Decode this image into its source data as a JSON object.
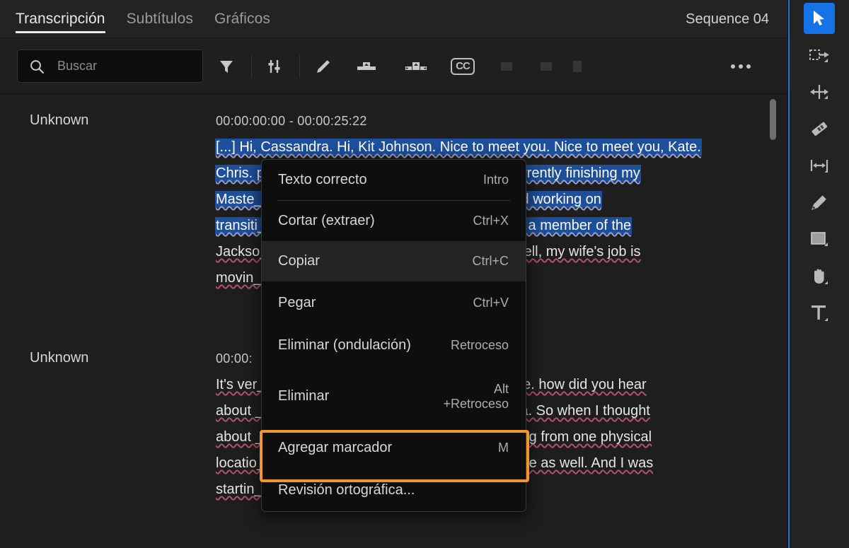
{
  "app": {
    "sequence_title": "Sequence 04"
  },
  "tabs": [
    {
      "label": "Transcripción",
      "active": true
    },
    {
      "label": "Subtítulos",
      "active": false
    },
    {
      "label": "Gráficos",
      "active": false
    }
  ],
  "toolbar": {
    "search_placeholder": "Buscar",
    "search_value": "",
    "icons": [
      {
        "name": "search-icon"
      },
      {
        "name": "filter-funnel-icon"
      },
      {
        "name": "sliders-icon"
      },
      {
        "name": "pencil-edit-icon"
      },
      {
        "name": "merge-clips-icon"
      },
      {
        "name": "split-clip-icon"
      },
      {
        "name": "closed-captions-icon",
        "label": "CC"
      },
      {
        "name": "more-options-icon"
      }
    ]
  },
  "transcript": {
    "blocks": [
      {
        "speaker": "Unknown",
        "timecode": "00:00:00:00 - 00:00:25:22",
        "lines": [
          {
            "text": "[...] Hi, Cassandra. Hi, Kit Johnson. Nice to meet you. Nice to meet you, Kate.",
            "selected": true
          },
          {
            "text": "Chris. p____________________________ 'm currently finishing my",
            "selected": true
          },
          {
            "text": "Maste___________________________ lege, and working on",
            "selected": true
          },
          {
            "text": "transiti___________________________ to being a member of the",
            "selected": true
          },
          {
            "text": "Jackso___________________________ ove? Well, my wife's job is",
            "selected": false
          },
          {
            "text": "movin____________________________ th her.",
            "selected": false
          }
        ]
      },
      {
        "speaker": "Unknown",
        "timecode": "00:00:",
        "lines": [
          {
            "text": "It's ver__________________________ same time. how did you hear",
            "selected": false
          },
          {
            "text": "about ___________________________ re at Aria. So when I thought",
            "selected": false
          },
          {
            "text": "about ___________________________ nd moving from one physical",
            "selected": false
          },
          {
            "text": "locatio__________________________ areer move as well. And I was",
            "selected": false
          },
          {
            "text": "startin__________________________",
            "selected": false
          }
        ]
      }
    ]
  },
  "context_menu": {
    "items": [
      {
        "label": "Texto correcto",
        "accel": "Intro",
        "separator_after": true,
        "hover": false
      },
      {
        "label": "Cortar (extraer)",
        "accel": "Ctrl+X",
        "hover": false
      },
      {
        "label": "Copiar",
        "accel": "Ctrl+C",
        "hover": true
      },
      {
        "label": "Pegar",
        "accel": "Ctrl+V",
        "hover": false
      },
      {
        "label": "Eliminar (ondulación)",
        "accel": "Retroceso",
        "hover": false
      },
      {
        "label": "Eliminar",
        "accel": "Alt\n+Retroceso",
        "hover": false,
        "two_line": true
      },
      {
        "label": "Agregar marcador",
        "accel": "M",
        "hover": false,
        "highlighted": true
      },
      {
        "label": "Revisión ortográfica...",
        "accel": "",
        "hover": false
      }
    ]
  },
  "tools": [
    {
      "name": "selection-tool",
      "active": true
    },
    {
      "name": "track-select-forward-tool",
      "active": false
    },
    {
      "name": "ripple-edit-tool",
      "active": false
    },
    {
      "name": "razor-tool",
      "active": false
    },
    {
      "name": "rate-stretch-tool",
      "active": false
    },
    {
      "name": "pen-tool",
      "active": false
    },
    {
      "name": "rectangle-tool",
      "active": false
    },
    {
      "name": "hand-tool",
      "active": false
    },
    {
      "name": "type-tool",
      "active": false
    }
  ],
  "colors": {
    "accent_blue": "#1473e6",
    "selection_blue": "#1d4f9c",
    "annotation_orange": "#f0952a",
    "panel_bg": "#1e1e1e",
    "menu_bg": "#0e0e0e"
  }
}
